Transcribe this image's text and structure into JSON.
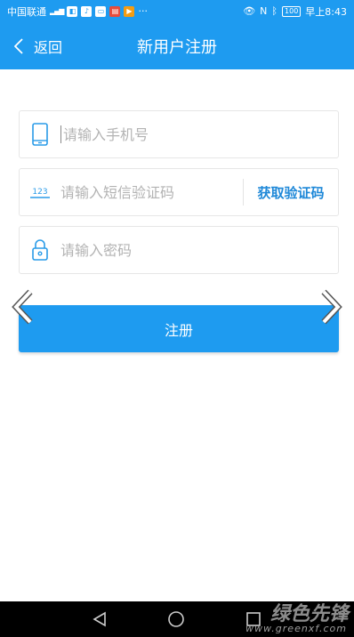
{
  "status_bar": {
    "carrier": "中国联通",
    "network": "4G",
    "battery": "100",
    "time": "早上8:43"
  },
  "nav": {
    "back_label": "返回",
    "title": "新用户注册"
  },
  "form": {
    "phone_placeholder": "请输入手机号",
    "sms_code_placeholder": "请输入短信验证码",
    "get_code_label": "获取验证码",
    "password_placeholder": "请输入密码",
    "code_icon_text": "123"
  },
  "register_button": {
    "label": "注册"
  },
  "watermark": {
    "brand": "绿色先锋",
    "url": "www.greenxf.com"
  },
  "colors": {
    "primary": "#1e9bf0",
    "link": "#1e88d8",
    "placeholder": "#b3b3b3",
    "border": "#e6e6e6"
  }
}
